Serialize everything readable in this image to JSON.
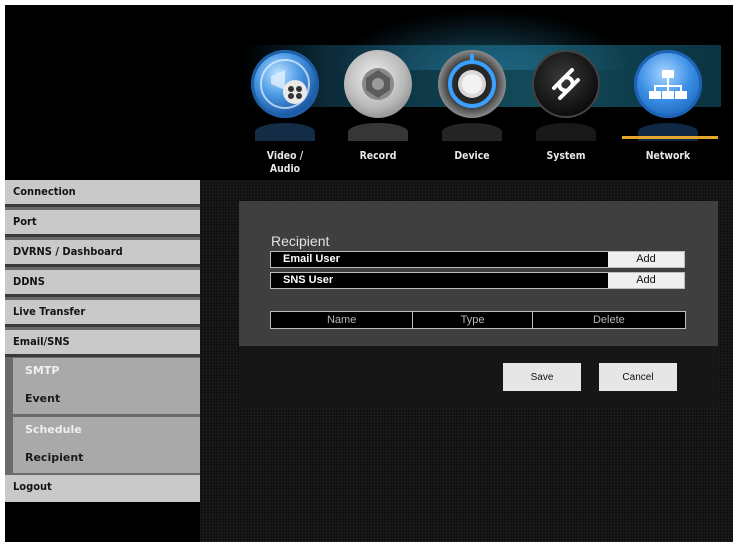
{
  "nav": {
    "items": [
      {
        "label": "Video / Audio",
        "icon": "film-reel-icon"
      },
      {
        "label": "Record",
        "icon": "camera-shutter-icon"
      },
      {
        "label": "Device",
        "icon": "dial-icon"
      },
      {
        "label": "System",
        "icon": "system-link-icon"
      },
      {
        "label": "Network",
        "icon": "network-icon"
      }
    ],
    "active": "Network",
    "accent_color": "#e8a62c"
  },
  "sidebar": {
    "items": [
      {
        "label": "Connection"
      },
      {
        "label": "Port"
      },
      {
        "label": "DVRNS / Dashboard"
      },
      {
        "label": "DDNS"
      },
      {
        "label": "Live Transfer"
      },
      {
        "label": "Email/SNS"
      }
    ],
    "subitems": [
      {
        "label": "SMTP"
      },
      {
        "label": "Event"
      },
      {
        "label": "Schedule"
      },
      {
        "label": "Recipient"
      }
    ],
    "logout": "Logout"
  },
  "recipient": {
    "title": "Recipient",
    "email_user_label": "Email User",
    "sns_user_label": "SNS User",
    "add_label": "Add",
    "table_columns": [
      "Name",
      "Type",
      "Delete"
    ]
  },
  "actions": {
    "save_label": "Save",
    "cancel_label": "Cancel"
  }
}
